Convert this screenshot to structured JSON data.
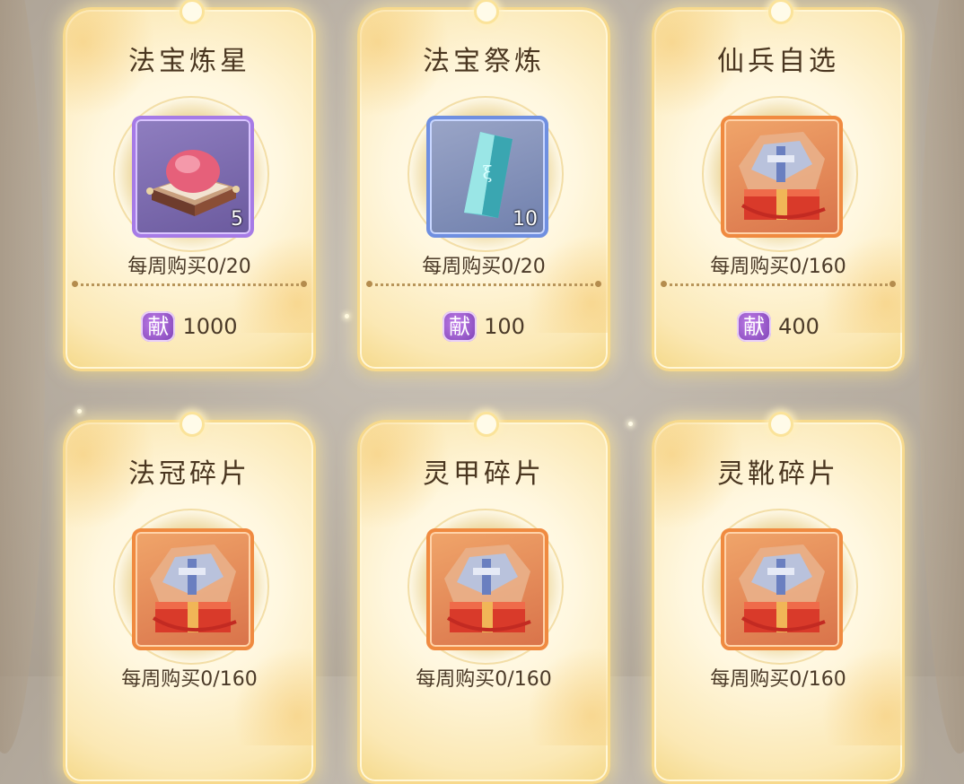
{
  "currency_icon": {
    "name": "offering-token-icon",
    "glyph": "献",
    "color": "#8b4fc2"
  },
  "items": [
    {
      "title": "法宝炼星",
      "limit": "每周购买0/20",
      "price": "1000",
      "count": "5",
      "frame": "purple",
      "icon": "pink-gem-on-cushion-icon"
    },
    {
      "title": "法宝祭炼",
      "limit": "每周购买0/20",
      "price": "100",
      "count": "10",
      "frame": "blue",
      "icon": "jade-talisman-shard-icon"
    },
    {
      "title": "仙兵自选",
      "limit": "每周购买0/160",
      "price": "400",
      "count": "",
      "frame": "orange",
      "icon": "weapon-gift-box-icon"
    },
    {
      "title": "法冠碎片",
      "limit": "每周购买0/160",
      "price": "",
      "count": "",
      "frame": "orange",
      "icon": "weapon-gift-box-icon"
    },
    {
      "title": "灵甲碎片",
      "limit": "每周购买0/160",
      "price": "",
      "count": "",
      "frame": "orange",
      "icon": "weapon-gift-box-icon"
    },
    {
      "title": "灵靴碎片",
      "limit": "每周购买0/160",
      "price": "",
      "count": "",
      "frame": "orange",
      "icon": "weapon-gift-box-icon"
    }
  ]
}
